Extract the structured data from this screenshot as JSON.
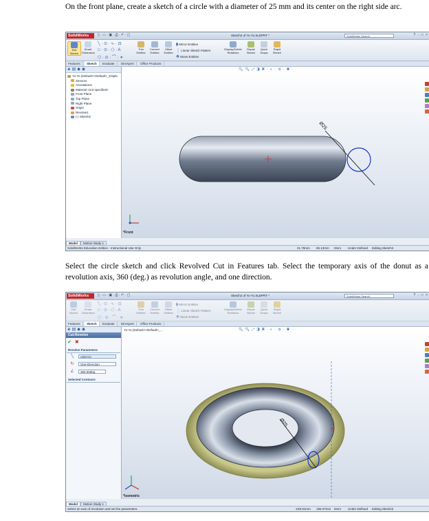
{
  "instructions": {
    "step1": "On the front plane, create a sketch of a circle with a diameter of 25 mm and its center on the right side arc.",
    "step2": "Select the circle sketch and click Revolved Cut in Features tab. Select the temporary axis of the donut as a revolution axis, 360 (deg.) as revolution angle, and one direction."
  },
  "screenshot1": {
    "logo": "SolidWorks",
    "window_title": "Sketch2 of Yo-Yo.SLDPRT *",
    "search_placeholder": "SolidWorks Search",
    "window_buttons": "? - □ ×",
    "ribbon": {
      "exit_sketch": "Exit Sketch",
      "smart_dimension": "Smart Dimension",
      "trim": "Trim Entities",
      "convert": "Convert Entities",
      "offset": "Offset Entities",
      "mirror": "Mirror Entities",
      "linear_pattern": "Linear Sketch Pattern",
      "move": "Move Entities",
      "display_delete": "Display/Delete Relations",
      "repair": "Repair Sketch",
      "quick_snaps": "Quick Snaps",
      "rapid_sketch": "Rapid Sketch"
    },
    "tabs": [
      "Features",
      "Sketch",
      "Evaluate",
      "DimXpert",
      "Office Products"
    ],
    "active_tab": "Sketch",
    "tree": [
      "Yo-Yo (Default<<Default>_Disple",
      "Sensors",
      "Annotations",
      "Material <not specified>",
      "Front Plane",
      "Top Plane",
      "Right Plane",
      "Origin",
      "Revolve1",
      "(-) Sketch2"
    ],
    "dimension_label": "Ø25",
    "view_label": "*Front",
    "bottom_tabs": [
      "Model",
      "Motion Study 1"
    ],
    "status": {
      "left": "SolidWorks Education Edition - Instructional Use Only",
      "x": "21.79mm",
      "y": "65.13mm",
      "z": "0mm",
      "state": "Under Defined",
      "editing": "Editing Sketch2"
    }
  },
  "screenshot2": {
    "logo": "SolidWorks",
    "window_title": "Sketch2 of Yo-Yo.SLDPRT *",
    "search_placeholder": "SolidWorks Search",
    "window_buttons": "? - □ ×",
    "tabs": [
      "Features",
      "Sketch",
      "Evaluate",
      "DimXpert",
      "Office Products"
    ],
    "active_tab": "Sketch",
    "tree_root": "Yo-Yo (Default<<Default>_...",
    "property_manager": {
      "title": "Cut-Revolve",
      "ok": "✔",
      "cancel": "✖",
      "section_params": "Revolve Parameters",
      "axis": "Axis<1>",
      "direction": "One-Direction",
      "angle": "360.00deg",
      "section_contours": "Selected Contours"
    },
    "dimension_label": "Ø25",
    "view_label": "*Isometric",
    "bottom_tabs": [
      "Model",
      "Motion Study 1"
    ],
    "status": {
      "left": "Select an axis of revolution and set the parameters.",
      "x": "-159.81mm",
      "y": "196.07mm",
      "z": "0mm",
      "state": "Under Defined",
      "editing": "Editing Sketch2"
    }
  }
}
